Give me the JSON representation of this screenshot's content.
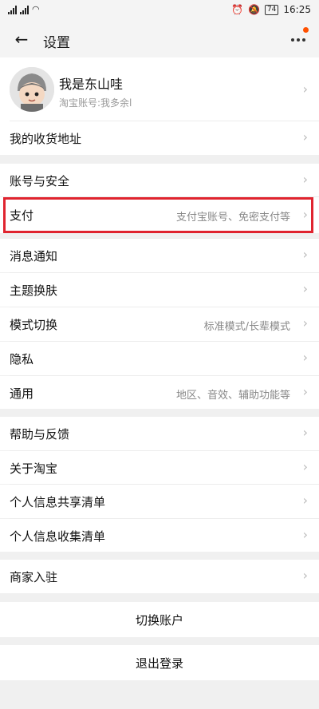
{
  "status_bar": {
    "time": "16:25",
    "battery": "74"
  },
  "header": {
    "title": "设置"
  },
  "profile": {
    "name": "我是东山哇",
    "account": "淘宝账号:我多余l"
  },
  "rows": {
    "address": {
      "label": "我的收货地址"
    },
    "account_security": {
      "label": "账号与安全"
    },
    "payment": {
      "label": "支付",
      "value": "支付宝账号、免密支付等"
    },
    "notifications": {
      "label": "消息通知"
    },
    "theme": {
      "label": "主题换肤"
    },
    "mode": {
      "label": "模式切换",
      "value": "标准模式/长辈模式"
    },
    "privacy": {
      "label": "隐私"
    },
    "general": {
      "label": "通用",
      "value": "地区、音效、辅助功能等"
    },
    "help": {
      "label": "帮助与反馈"
    },
    "about": {
      "label": "关于淘宝"
    },
    "info_share": {
      "label": "个人信息共享清单"
    },
    "info_collect": {
      "label": "个人信息收集清单"
    },
    "merchant": {
      "label": "商家入驻"
    }
  },
  "actions": {
    "switch_account": "切换账户",
    "logout": "退出登录"
  },
  "chevron": "›",
  "colors": {
    "accent": "#ff5000",
    "highlight": "#e0242f"
  }
}
